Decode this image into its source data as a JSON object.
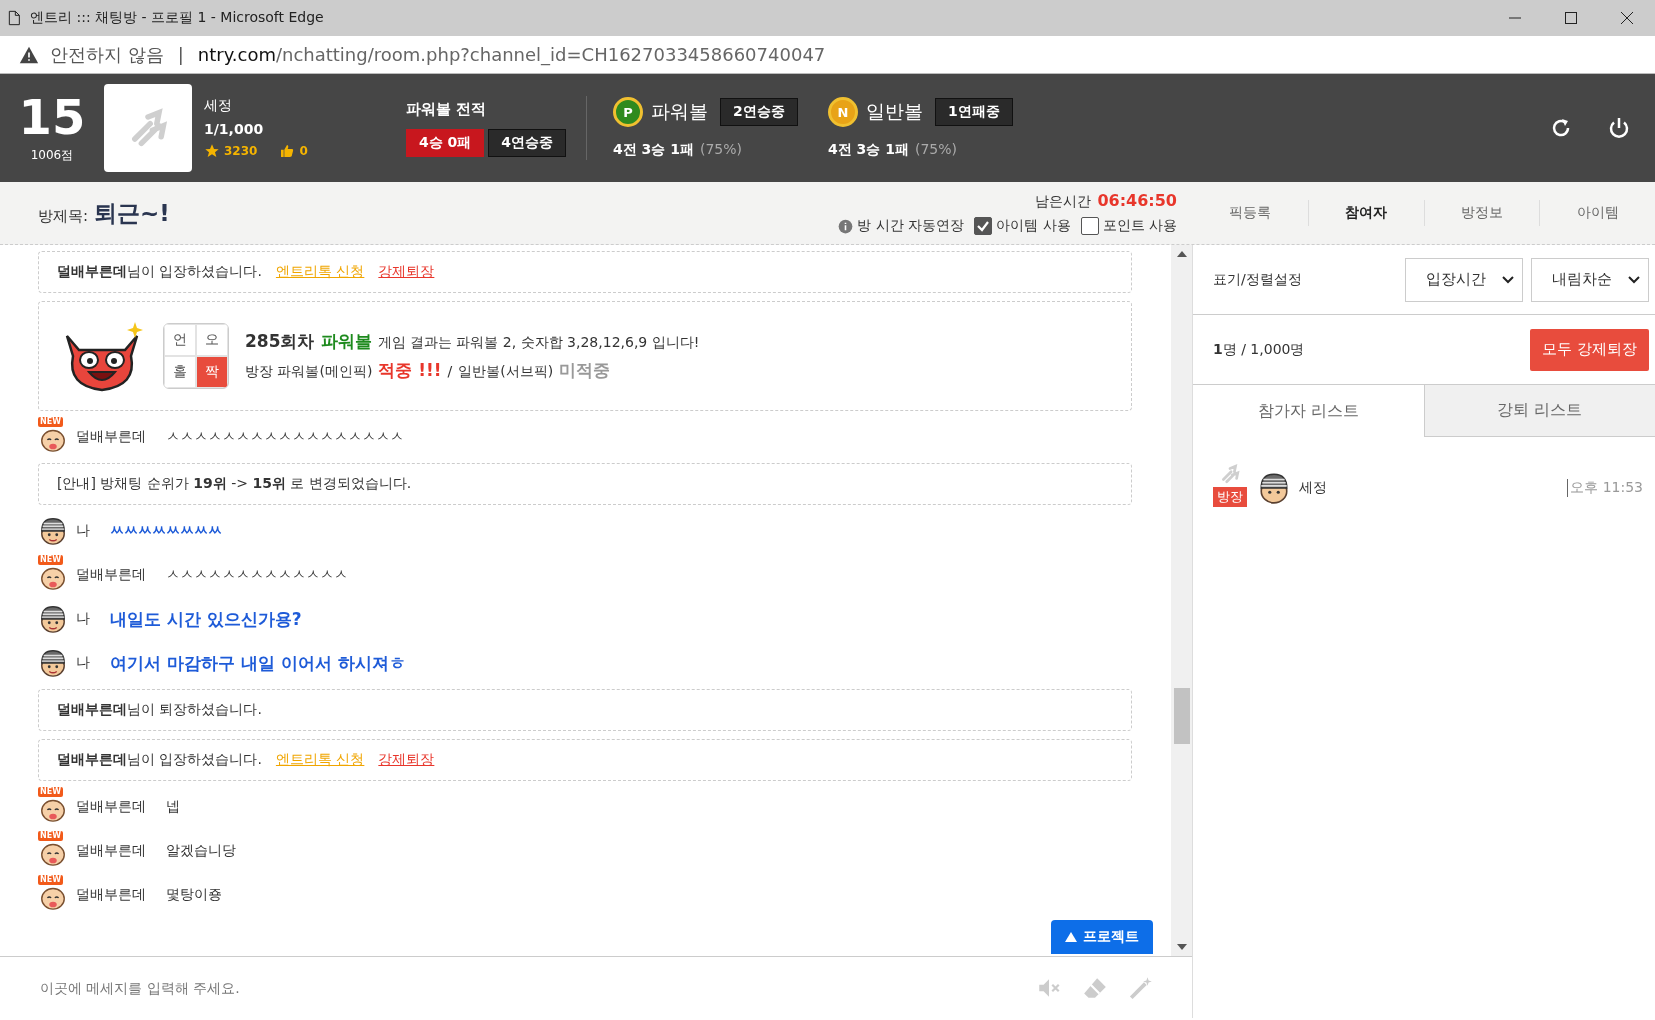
{
  "window": {
    "title": "엔트리 ::: 채팅방 - 프로필 1 - Microsoft Edge"
  },
  "address_bar": {
    "warning": "안전하지 않음",
    "separator": "|",
    "host": "ntry.com",
    "path": "/nchatting/room.php?channel_id=CH1627033458660740047"
  },
  "header": {
    "rank": "15",
    "points": "1006점",
    "name": "세정",
    "members": "1/1,000",
    "stars": "3230",
    "likes": "0",
    "record": {
      "title": "파워볼 전적",
      "badges": [
        {
          "text": "4승 0패",
          "kind": "record"
        },
        {
          "text": "4연승중",
          "kind": "streak"
        }
      ]
    },
    "balls": [
      {
        "letter": "P",
        "color": "#2f8a1e",
        "name": "파워볼",
        "streak": "2연승중",
        "summary": "4전 3승 1패",
        "rate": "(75%)"
      },
      {
        "letter": "N",
        "color": "#e8a317",
        "name": "일반볼",
        "streak": "1연패중",
        "summary": "4전 3승 1패",
        "rate": "(75%)"
      }
    ]
  },
  "room": {
    "label": "방제목:",
    "title": "퇴근~!",
    "time_label": "남은시간",
    "time": "06:46:50",
    "options": [
      {
        "kind": "info",
        "label": "방 시간 자동연장"
      },
      {
        "kind": "checkbox",
        "label": "아이템 사용",
        "checked": true
      },
      {
        "kind": "checkbox",
        "label": "포인트 사용",
        "checked": false
      }
    ]
  },
  "tabs": [
    {
      "label": "픽등록",
      "selected": false
    },
    {
      "label": "참여자",
      "selected": true
    },
    {
      "label": "방정보",
      "selected": false
    },
    {
      "label": "아이템",
      "selected": false
    }
  ],
  "messages": [
    {
      "kind": "notice",
      "text": "**덜배부른데**님이 입장하셨습니다.",
      "links": [
        {
          "text": "엔트리톡 신청",
          "kind": "entry"
        },
        {
          "text": "강제퇴장",
          "kind": "kick"
        }
      ]
    },
    {
      "kind": "result",
      "board": [
        {
          "text": "언",
          "selected": false
        },
        {
          "text": "오",
          "selected": false
        },
        {
          "text": "홀",
          "selected": false
        },
        {
          "text": "짝",
          "selected": true
        }
      ],
      "round": "285회차",
      "game": "파워볼",
      "line": "게임 결과는 파워볼 2, 숫자합 3,28,12,6,9 입니다!",
      "picks": [
        {
          "label": "방장 파워볼(메인픽)",
          "result": "적중 !!!",
          "hit": true
        },
        {
          "label": "일반볼(서브픽)",
          "result": "미적중",
          "hit": false
        }
      ],
      "separator": "/"
    },
    {
      "kind": "chat-new",
      "tag": "NEW",
      "name": "덜배부른데",
      "text": "ㅅㅅㅅㅅㅅㅅㅅㅅㅅㅅㅅㅅㅅㅅㅅㅅㅅ"
    },
    {
      "kind": "notice",
      "text": "[안내] 방채팅 순위가 **19위** -> **15위** 로 변경되었습니다."
    },
    {
      "kind": "chat-mine",
      "name": "나",
      "text": "ㅆㅆㅆㅆㅆㅆㅆㅆ"
    },
    {
      "kind": "chat-new",
      "tag": "NEW",
      "name": "덜배부른데",
      "text": "ㅅㅅㅅㅅㅅㅅㅅㅅㅅㅅㅅㅅㅅ"
    },
    {
      "kind": "chat-mine-big",
      "name": "나",
      "text": "내일도 시간 있으신가용?"
    },
    {
      "kind": "chat-mine-big",
      "name": "나",
      "text": "여기서 마감하구 내일 이어서 하시져ㅎ"
    },
    {
      "kind": "notice",
      "text": "**덜배부른데**님이 퇴장하셨습니다."
    },
    {
      "kind": "notice",
      "text": "**덜배부른데**님이 입장하셨습니다.",
      "links": [
        {
          "text": "엔트리톡 신청",
          "kind": "entry"
        },
        {
          "text": "강제퇴장",
          "kind": "kick"
        }
      ]
    },
    {
      "kind": "chat-new",
      "tag": "NEW",
      "name": "덜배부른데",
      "text": "넵"
    },
    {
      "kind": "chat-new",
      "tag": "NEW",
      "name": "덜배부른데",
      "text": "알겠습니당"
    },
    {
      "kind": "chat-new",
      "tag": "NEW",
      "name": "덜배부른데",
      "text": "몇탕이죵"
    }
  ],
  "project_button": "프로젝트",
  "input": {
    "placeholder": "이곳에 메세지를 입력해 주세요."
  },
  "panel": {
    "sort_label": "표기/정렬설정",
    "selects": [
      "입장시간",
      "내림차순"
    ],
    "count": "**1**명 / 1,000명",
    "kick_all": "모두 강제퇴장",
    "list_tabs": [
      {
        "label": "참가자 리스트",
        "selected": true
      },
      {
        "label": "강퇴 리스트",
        "selected": false
      }
    ],
    "participants": [
      {
        "name": "세정",
        "role": "방장",
        "time": "오후 11:53"
      }
    ]
  }
}
